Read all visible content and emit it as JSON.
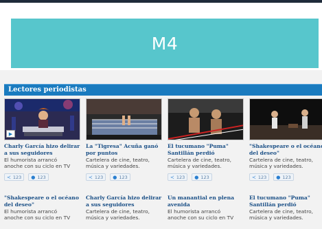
{
  "banner": {
    "label": "M4"
  },
  "section": {
    "title": "Lectores periodistas"
  },
  "cards": [
    {
      "title": "Charly García hizo delirar a sus seguidores",
      "desc1": "El humorista arrancó",
      "desc2": "anoche con su ciclo en TV",
      "shares": "123",
      "comments": "123"
    },
    {
      "title": "La \"Tigresa\" Acuña ganó por puntos",
      "desc1": "Cartelera de cine, teatro,",
      "desc2": "música y variedades.",
      "shares": "123",
      "comments": "123"
    },
    {
      "title": "El tucumano \"Puma\" Santillán perdió",
      "desc1": "Cartelera de cine, teatro,",
      "desc2": "música y variedades.",
      "shares": "123",
      "comments": "123"
    },
    {
      "title": "\"Shakespeare o el océano del deseo\"",
      "desc1": "Cartelera de cine, teatro,",
      "desc2": "música y variedades.",
      "shares": "123",
      "comments": "123"
    },
    {
      "title": "\"Shakespeare o el océano del deseo\"",
      "desc1": "El humorista arrancó",
      "desc2": "anoche con su ciclo en TV"
    },
    {
      "title": "Charly García hizo delirar a sus seguidores",
      "desc1": "Cartelera de cine, teatro,",
      "desc2": "música y variedades."
    },
    {
      "title": "Un manantial en plena avenida",
      "desc1": "El humorista arrancó",
      "desc2": "anoche con su ciclo en TV"
    },
    {
      "title": "El tucumano \"Puma\" Santillán perdió",
      "desc1": "Cartelera de cine, teatro,",
      "desc2": "música y variedades."
    }
  ],
  "colors": {
    "accent": "#57c6cc",
    "section": "#1a7bbf",
    "headline": "#1a4f86"
  }
}
